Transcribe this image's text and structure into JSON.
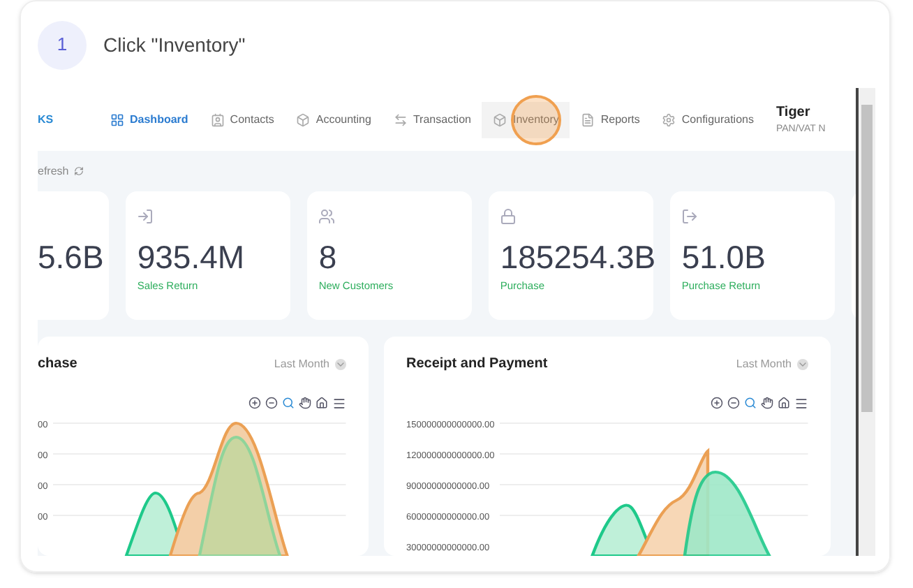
{
  "step": {
    "number": "1",
    "text": "Click \"Inventory\""
  },
  "nav": {
    "logo": "KS",
    "items": [
      {
        "label": "Dashboard",
        "kind": "dashboard",
        "selected": true,
        "highlighted": false
      },
      {
        "label": "Contacts",
        "kind": "contacts",
        "selected": false,
        "highlighted": false
      },
      {
        "label": "Accounting",
        "kind": "box",
        "selected": false,
        "highlighted": false
      },
      {
        "label": "Transaction",
        "kind": "transfer",
        "selected": false,
        "highlighted": false
      },
      {
        "label": "Inventory",
        "kind": "box",
        "selected": false,
        "highlighted": true
      },
      {
        "label": "Reports",
        "kind": "reports",
        "selected": false,
        "highlighted": false
      },
      {
        "label": "Configurations",
        "kind": "settings",
        "selected": false,
        "highlighted": false
      }
    ],
    "company": {
      "name": "Tiger",
      "subtitle": "PAN/VAT N"
    }
  },
  "refresh": "efresh",
  "stats": [
    {
      "kind": "partial",
      "value": "5.6B"
    },
    {
      "kind": "return",
      "value": "935.4M",
      "label": "Sales Return"
    },
    {
      "kind": "customers",
      "value": "8",
      "label": "New Customers"
    },
    {
      "kind": "purchase",
      "value": "185254.3B",
      "label": "Purchase"
    },
    {
      "kind": "outgoing",
      "value": "51.0B",
      "label": "Purchase Return"
    }
  ],
  "charts": [
    {
      "title": "chase",
      "filter": "Last Month",
      "yticks": [
        "00",
        "00",
        "00",
        "00"
      ]
    },
    {
      "title": "Receipt and Payment",
      "filter": "Last Month",
      "yticks": [
        "150000000000000.00",
        "120000000000000.00",
        "90000000000000.00",
        "60000000000000.00",
        "30000000000000.00"
      ]
    }
  ]
}
